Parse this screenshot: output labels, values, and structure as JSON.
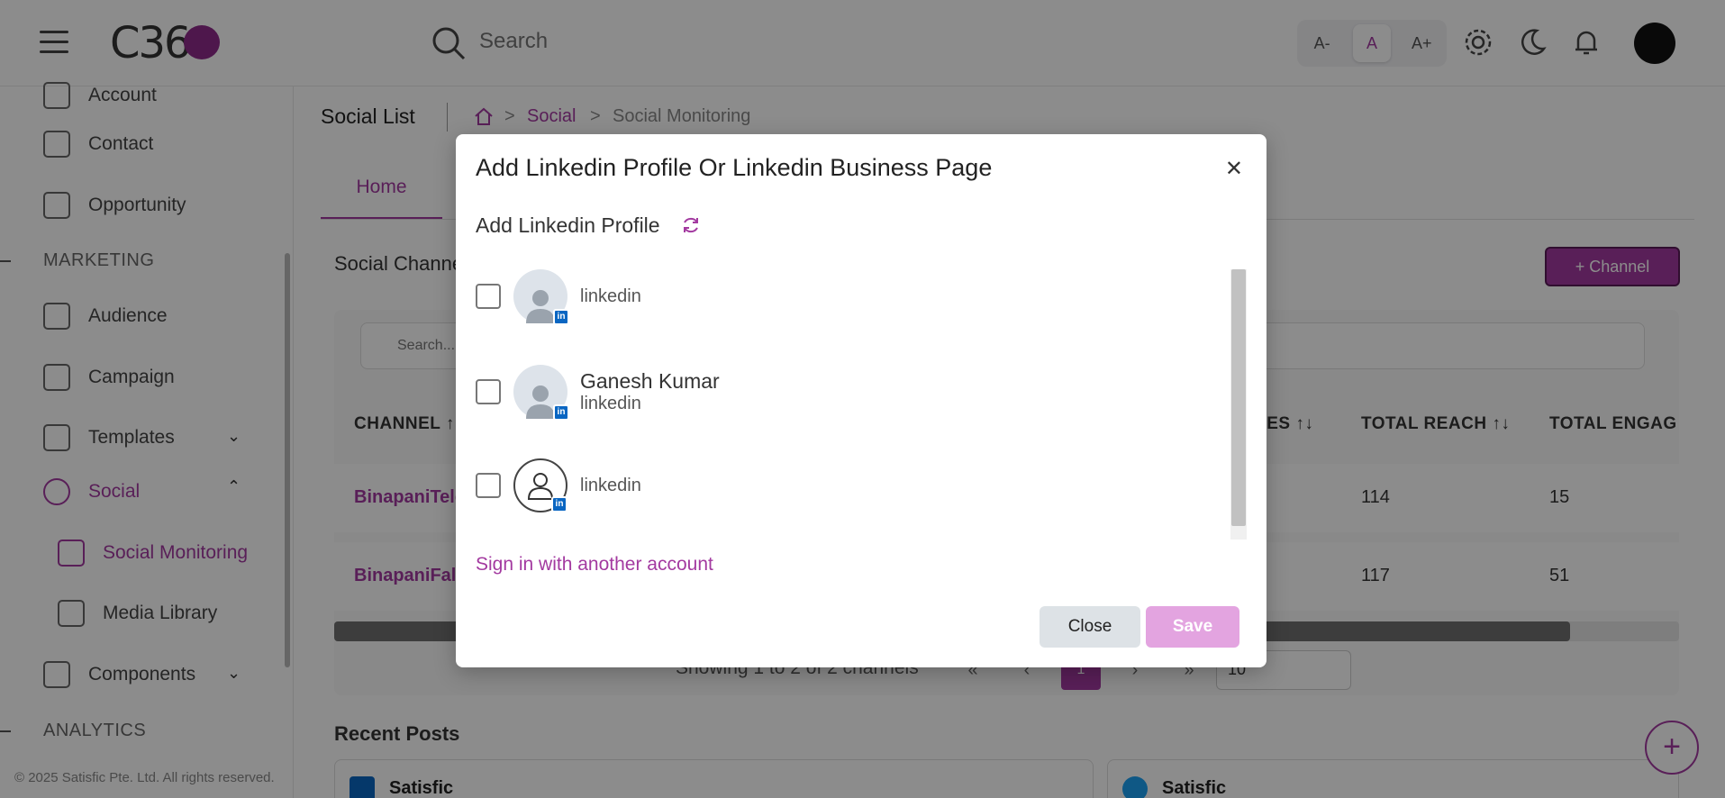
{
  "header": {
    "logo_text": "C36",
    "search_placeholder": "Search",
    "font_small": "A-",
    "font_normal": "A",
    "font_large": "A+"
  },
  "sidebar": {
    "items": [
      {
        "label": "Account"
      },
      {
        "label": "Contact"
      },
      {
        "label": "Opportunity"
      },
      {
        "label": "Audience"
      },
      {
        "label": "Campaign"
      },
      {
        "label": "Templates"
      },
      {
        "label": "Social"
      },
      {
        "label": "Social Monitoring"
      },
      {
        "label": "Media Library"
      },
      {
        "label": "Components"
      }
    ],
    "section_marketing": "MARKETING",
    "section_analytics": "ANALYTICS",
    "copyright": "© 2025 Satisfic Pte. Ltd. All rights reserved."
  },
  "main": {
    "title": "Social List",
    "breadcrumb": [
      "Social",
      "Social Monitoring"
    ],
    "tab_home": "Home",
    "channels_title": "Social Channe",
    "add_channel": "+ Channel",
    "table_search_placeholder": "Search...",
    "columns": [
      "CHANNEL ↑",
      "RES ↑↓",
      "TOTAL REACH ↑↓",
      "TOTAL ENGAG"
    ],
    "rows": [
      {
        "channel": "BinapaniTele",
        "reach": "114",
        "engagement": "15"
      },
      {
        "channel": "BinapaniFal",
        "reach": "117",
        "engagement": "51"
      }
    ],
    "pager_text": "Showing 1 to 2 of 2 channels",
    "pager_current": "1",
    "page_size": "10",
    "recent_posts": "Recent Posts",
    "post_cards": [
      "Satisfic",
      "Satisfic"
    ]
  },
  "modal": {
    "title": "Add Linkedin Profile Or Linkedin Business Page",
    "subtitle": "Add Linkedin Profile",
    "profiles": [
      {
        "name": "",
        "network": "linkedin"
      },
      {
        "name": "Ganesh Kumar",
        "network": "linkedin"
      },
      {
        "name": "",
        "network": "linkedin"
      }
    ],
    "sign_in_link": "Sign in with another account",
    "close_label": "Close",
    "save_label": "Save"
  },
  "colors": {
    "accent": "#a33aa0",
    "linkedin": "#0a66c2"
  }
}
